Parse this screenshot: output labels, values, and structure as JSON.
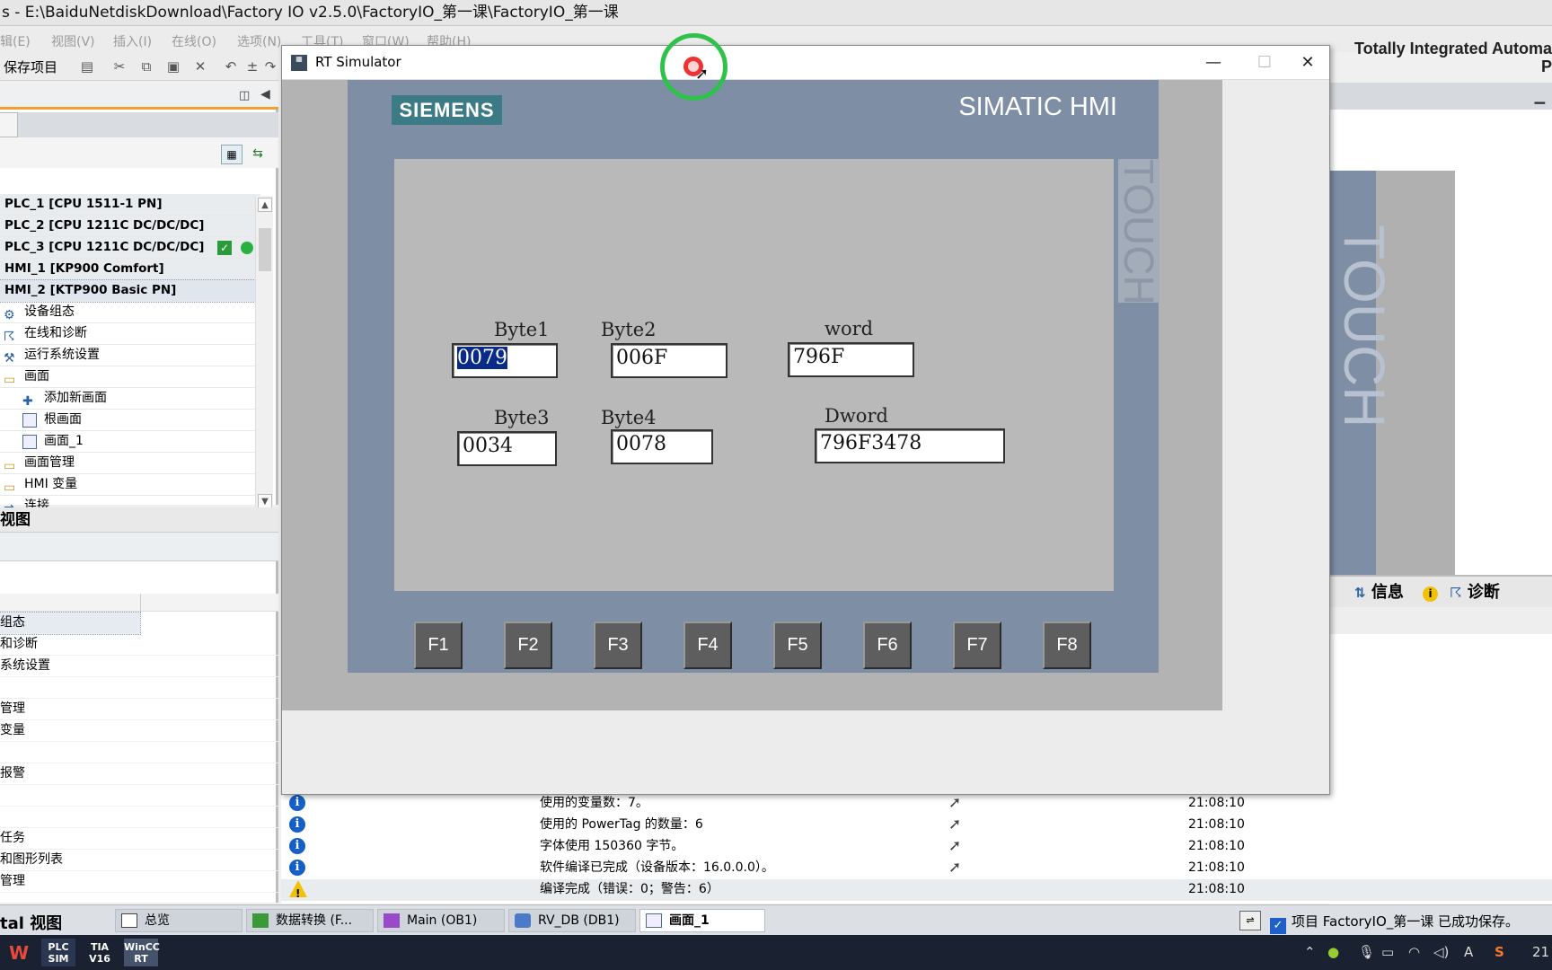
{
  "tia": {
    "title": "s  -  E:\\BaiduNetdiskDownload\\Factory IO v2.5.0\\FactoryIO_第一课\\FactoryIO_第一课",
    "menus": [
      "辑(E)",
      "视图(V)",
      "插入(I)",
      "在线(O)",
      "选项(N)",
      "工具(T)",
      "窗口(W)",
      "帮助(H)"
    ],
    "brand_line1": "Totally Integrated Automa",
    "brand_line2": "P",
    "save_label": "保存项目"
  },
  "project_tree": {
    "devices": [
      {
        "label": "PLC_1 [CPU 1511-1 PN]"
      },
      {
        "label": "PLC_2 [CPU 1211C DC/DC/DC]"
      },
      {
        "label": "PLC_3 [CPU 1211C DC/DC/DC]"
      },
      {
        "label": "HMI_1 [KP900 Comfort]"
      },
      {
        "label": "HMI_2 [KTP900 Basic PN]"
      }
    ],
    "items": [
      {
        "label": "设备组态"
      },
      {
        "label": "在线和诊断"
      },
      {
        "label": "运行系统设置"
      },
      {
        "label": "画面"
      },
      {
        "label": "添加新画面"
      },
      {
        "label": "根画面"
      },
      {
        "label": "画面_1"
      },
      {
        "label": "画面管理"
      },
      {
        "label": "HMI 变量"
      },
      {
        "label": "连接"
      }
    ]
  },
  "detail_view": {
    "title": "视图",
    "rows": [
      "组态",
      "和诊断",
      "系统设置",
      "",
      "管理",
      "变量",
      "",
      "报警",
      "",
      "",
      "任务",
      "和图形列表",
      "管理"
    ]
  },
  "inspector": {
    "tab_info": "信息",
    "tab_diag": "诊断"
  },
  "messages": [
    {
      "type": "info",
      "text": "使用的变量数：7。",
      "time": "21:08:10"
    },
    {
      "type": "info",
      "text": "使用的 PowerTag 的数量：6",
      "time": "21:08:10"
    },
    {
      "type": "info",
      "text": "字体使用 150360 字节。",
      "time": "21:08:10"
    },
    {
      "type": "info",
      "text": "软件编译已完成（设备版本：16.0.0.0）。",
      "time": "21:08:10"
    },
    {
      "type": "warning",
      "text": "编译完成（错误：0；警告：6）",
      "time": "21:08:10"
    }
  ],
  "editor_tabs": {
    "portal_label": "tal 视图",
    "tabs": [
      {
        "label": "总览",
        "active": false
      },
      {
        "label": "数据转换 (F...",
        "active": false
      },
      {
        "label": "Main (OB1)",
        "active": false
      },
      {
        "label": "RV_DB (DB1)",
        "active": false
      },
      {
        "label": "画面_1",
        "active": true
      }
    ],
    "status": "项目 FactoryIO_第一课 已成功保存。"
  },
  "taskbar": {
    "apps": [
      "W",
      "PLC SIM",
      "TIA V16",
      "WinCC RT"
    ],
    "clock": "21",
    "ime": "A",
    "ime2": "S"
  },
  "rt_simulator": {
    "title": "RT Simulator",
    "brand": "SIEMENS",
    "product": "SIMATIC HMI",
    "touch_label": "TOUCH",
    "fields": {
      "byte1": {
        "label": "Byte1",
        "value": "0079"
      },
      "byte2": {
        "label": "Byte2",
        "value": "006F"
      },
      "byte3": {
        "label": "Byte3",
        "value": "0034"
      },
      "byte4": {
        "label": "Byte4",
        "value": "0078"
      },
      "word": {
        "label": "word",
        "value": "796F"
      },
      "dword": {
        "label": "Dword",
        "value": "796F3478"
      }
    },
    "function_keys": [
      "F1",
      "F2",
      "F3",
      "F4",
      "F5",
      "F6",
      "F7",
      "F8"
    ]
  },
  "colors": {
    "hmi_frame": "#7d8ea5",
    "siemens_logo": "#3c7a85",
    "hmi_screen": "#b9b9b9",
    "selection_highlight": "#0a2a8a"
  }
}
